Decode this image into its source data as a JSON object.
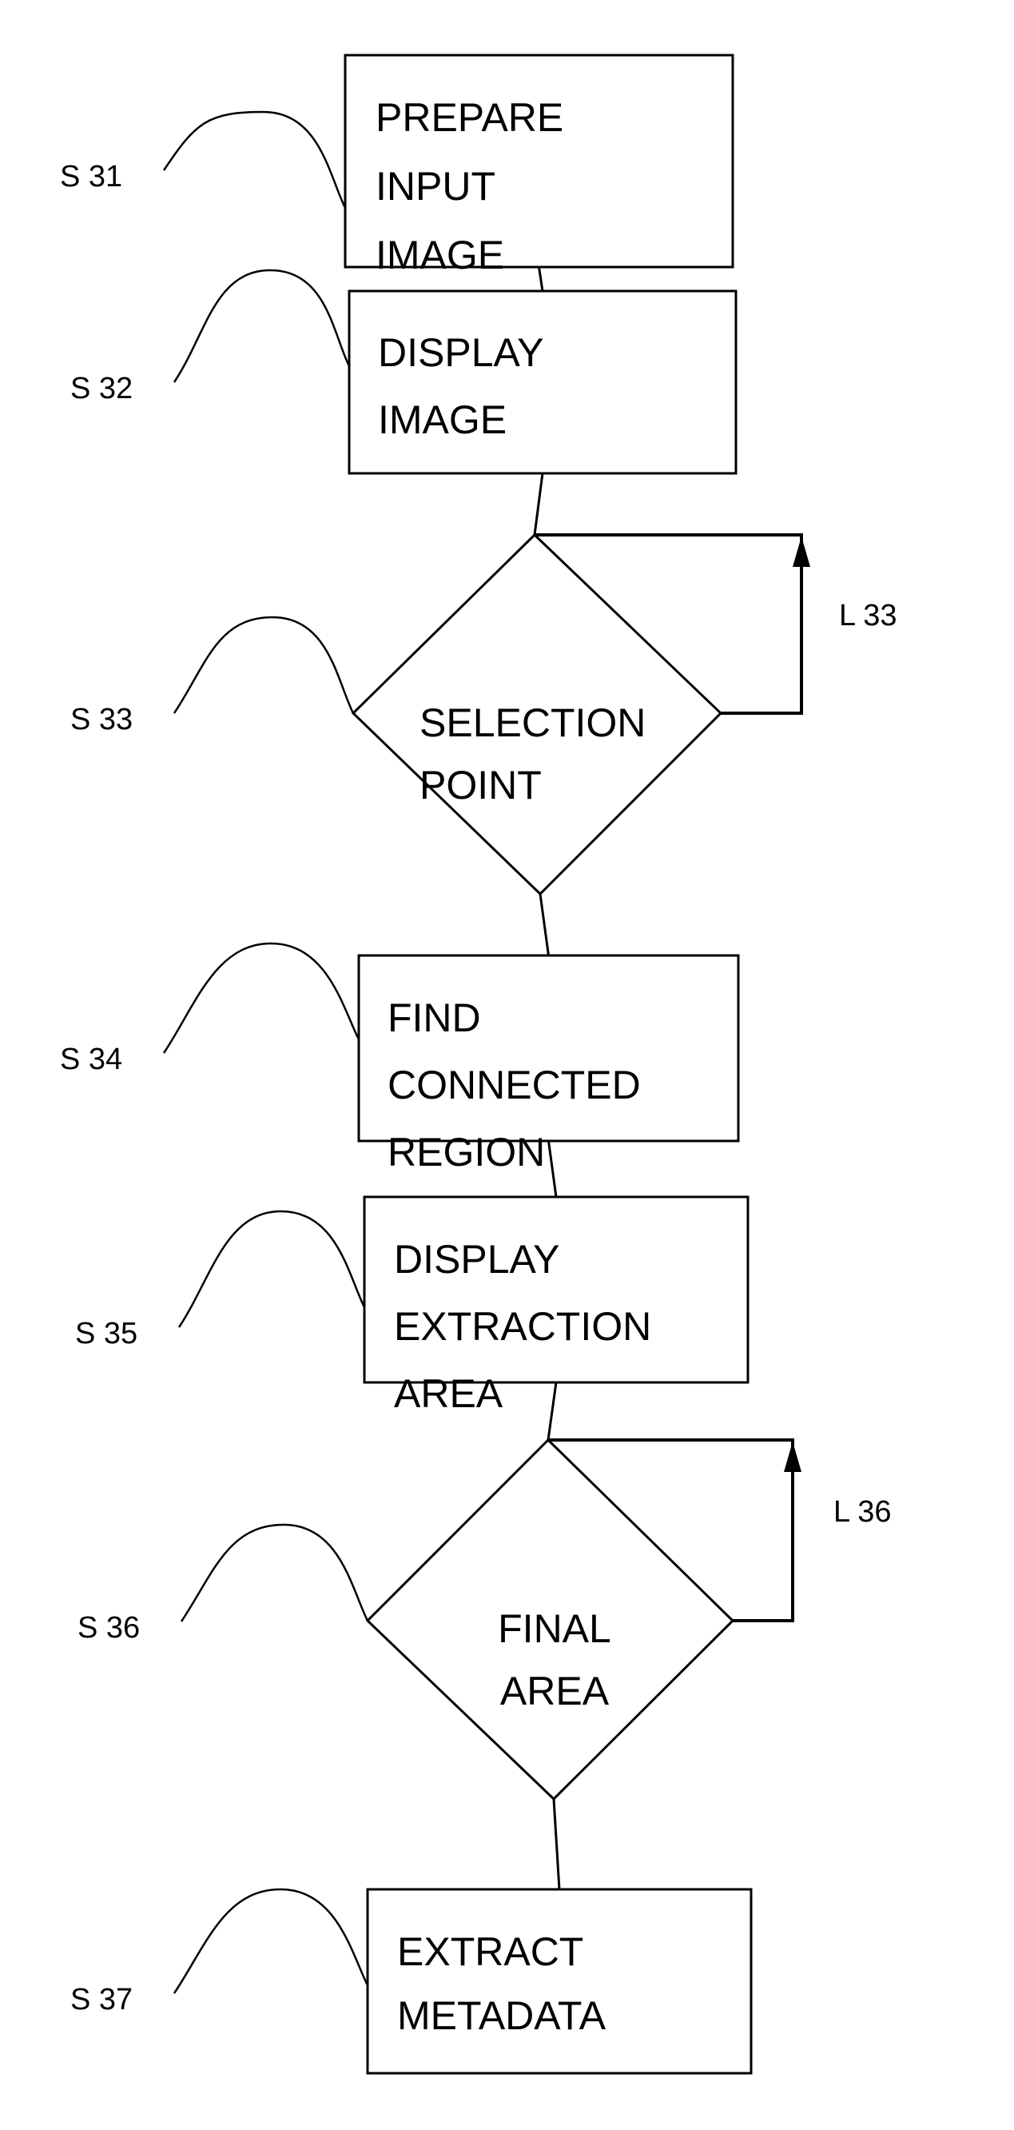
{
  "diagram": {
    "type": "flowchart",
    "colors": {
      "stroke": "#000000",
      "background": "#ffffff"
    },
    "nodes": [
      {
        "id": "S31",
        "shape": "process",
        "ref": "S 31",
        "lines": [
          "PREPARE",
          "INPUT",
          "IMAGE"
        ]
      },
      {
        "id": "S32",
        "shape": "process",
        "ref": "S 32",
        "lines": [
          "DISPLAY",
          "IMAGE"
        ]
      },
      {
        "id": "S33",
        "shape": "decision",
        "ref": "S 33",
        "lines": [
          "SELECTION",
          "POINT"
        ],
        "loop_label": "L 33"
      },
      {
        "id": "S34",
        "shape": "process",
        "ref": "S 34",
        "lines": [
          "FIND",
          "CONNECTED",
          "REGION"
        ]
      },
      {
        "id": "S35",
        "shape": "process",
        "ref": "S 35",
        "lines": [
          "DISPLAY",
          "EXTRACTION",
          "AREA"
        ]
      },
      {
        "id": "S36",
        "shape": "decision",
        "ref": "S 36",
        "lines": [
          "FINAL",
          "AREA"
        ],
        "loop_label": "L 36"
      },
      {
        "id": "S37",
        "shape": "process",
        "ref": "S 37",
        "lines": [
          "EXTRACT",
          "METADATA"
        ]
      }
    ],
    "edges": [
      {
        "from": "S31",
        "to": "S32"
      },
      {
        "from": "S32",
        "to": "S33"
      },
      {
        "from": "S33",
        "to": "S33",
        "kind": "loop",
        "label": "L 33"
      },
      {
        "from": "S33",
        "to": "S34"
      },
      {
        "from": "S34",
        "to": "S35"
      },
      {
        "from": "S35",
        "to": "S36"
      },
      {
        "from": "S36",
        "to": "S36",
        "kind": "loop",
        "label": "L 36"
      },
      {
        "from": "S36",
        "to": "S37"
      }
    ]
  }
}
